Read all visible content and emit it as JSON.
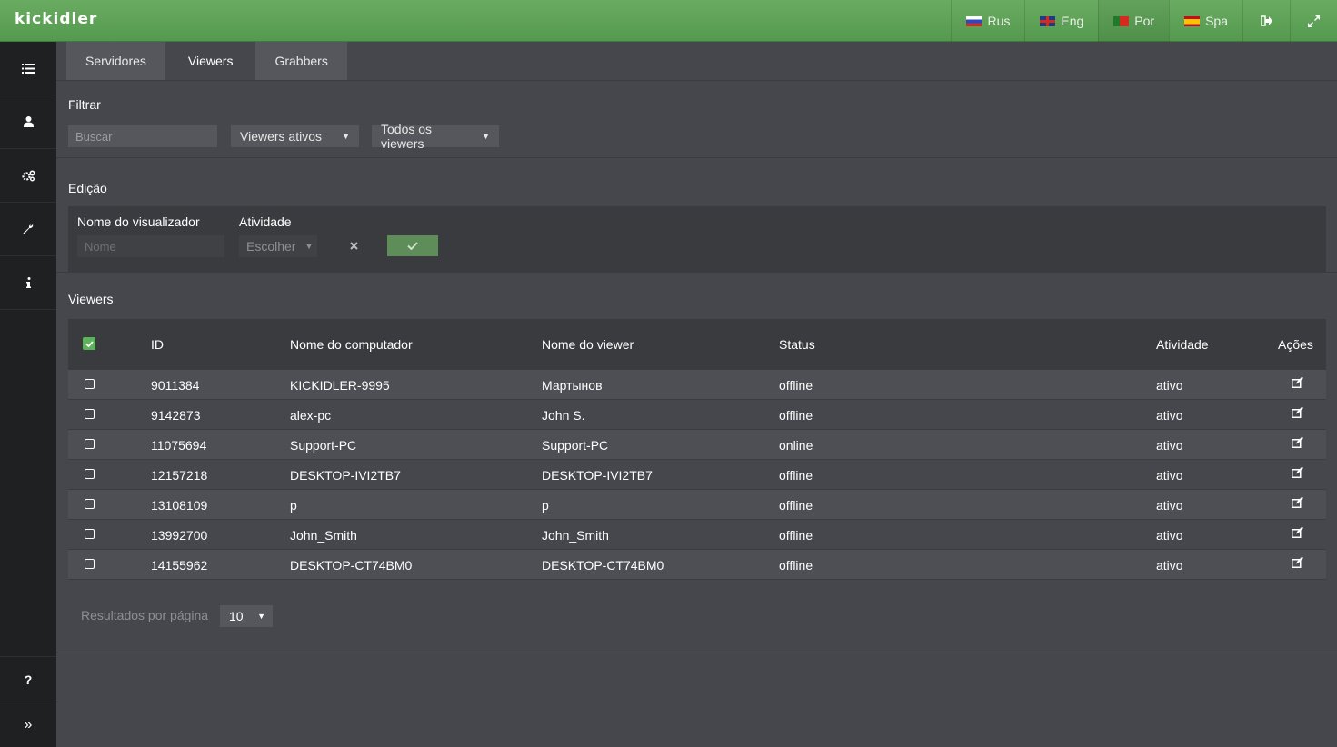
{
  "app": {
    "logo": "kickidler"
  },
  "topbar": {
    "languages": [
      {
        "label": "Rus",
        "flag": "ru-flag-icon"
      },
      {
        "label": "Eng",
        "flag": "uk-flag-icon"
      },
      {
        "label": "Por",
        "flag": "pt-flag-icon"
      },
      {
        "label": "Spa",
        "flag": "es-flag-icon"
      }
    ],
    "logout_icon": "logout-icon",
    "fullscreen_icon": "expand-icon"
  },
  "sidebar": {
    "items": [
      "list-icon",
      "user-icon",
      "cogs-icon",
      "wrench-icon",
      "info-icon"
    ],
    "help_glyph": "?",
    "collapse_glyph": "»"
  },
  "tabs": [
    {
      "label": "Servidores",
      "active": false
    },
    {
      "label": "Viewers",
      "active": true
    },
    {
      "label": "Grabbers",
      "active": false
    }
  ],
  "filter": {
    "title": "Filtrar",
    "search_placeholder": "Buscar",
    "status_select": "Viewers ativos",
    "scope_select": "Todos os viewers"
  },
  "edit": {
    "title": "Edição",
    "name_label": "Nome do visualizador",
    "name_placeholder": "Nome",
    "activity_label": "Atividade",
    "activity_select": "Escolher"
  },
  "viewers": {
    "title": "Viewers",
    "columns": {
      "id": "ID",
      "computer": "Nome do computador",
      "viewer": "Nome do viewer",
      "status": "Status",
      "activity": "Atividade",
      "actions": "Ações"
    },
    "rows": [
      {
        "id": "9011384",
        "computer": "KICKIDLER-9995",
        "viewer": "Мартынов",
        "status": "offline",
        "activity": "ativo"
      },
      {
        "id": "9142873",
        "computer": "alex-pc",
        "viewer": "John S.",
        "status": "offline",
        "activity": "ativo"
      },
      {
        "id": "11075694",
        "computer": "Support-PC",
        "viewer": "Support-PC",
        "status": "online",
        "activity": "ativo"
      },
      {
        "id": "12157218",
        "computer": "DESKTOP-IVI2TB7",
        "viewer": "DESKTOP-IVI2TB7",
        "status": "offline",
        "activity": "ativo"
      },
      {
        "id": "13108109",
        "computer": "p",
        "viewer": "p",
        "status": "offline",
        "activity": "ativo"
      },
      {
        "id": "13992700",
        "computer": "John_Smith",
        "viewer": "John_Smith",
        "status": "offline",
        "activity": "ativo"
      },
      {
        "id": "14155962",
        "computer": "DESKTOP-CT74BM0",
        "viewer": "DESKTOP-CT74BM0",
        "status": "offline",
        "activity": "ativo"
      }
    ]
  },
  "pagination": {
    "label": "Resultados por página",
    "value": "10"
  }
}
